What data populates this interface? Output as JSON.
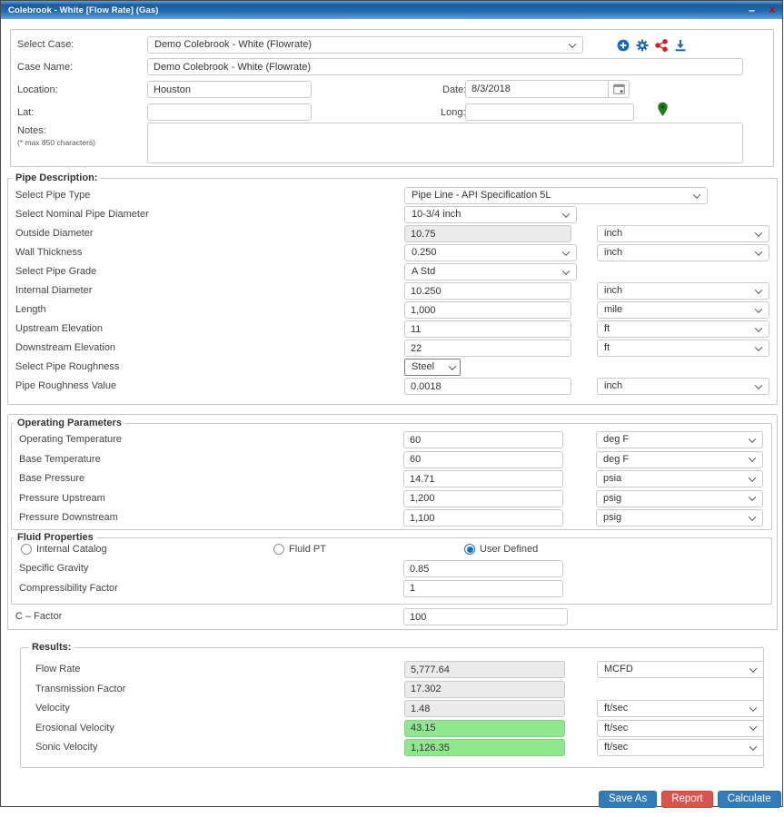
{
  "window": {
    "title": "Colebrook - White [Flow Rate] (Gas)",
    "minimize_label": "–",
    "close_label": "x"
  },
  "header_icons": [
    {
      "name": "add-circle-icon"
    },
    {
      "name": "gear-icon"
    },
    {
      "name": "share-icon"
    },
    {
      "name": "download-icon"
    }
  ],
  "case": {
    "select_case": {
      "label": "Select Case:",
      "value": "Demo Colebrook - White (Flowrate)"
    },
    "case_name": {
      "label": "Case Name:",
      "value": "Demo Colebrook - White (Flowrate)"
    },
    "location": {
      "label": "Location:",
      "value": "Houston"
    },
    "date": {
      "label": "Date:",
      "value": "8/3/2018"
    },
    "lat": {
      "label": "Lat:",
      "value": ""
    },
    "long": {
      "label": "Long:",
      "value": ""
    },
    "notes": {
      "label": "Notes:",
      "hint": "(* max 850 characters)",
      "value": ""
    }
  },
  "pipe": {
    "legend": "Pipe Description:",
    "pipe_type": {
      "label": "Select Pipe Type",
      "value": "Pipe Line - API Specification 5L"
    },
    "nominal_diameter": {
      "label": "Select Nominal Pipe Diameter",
      "value": "10-3/4 inch"
    },
    "outside_diameter": {
      "label": "Outside Diameter",
      "value": "10.75",
      "unit": "inch"
    },
    "wall_thickness": {
      "label": "Wall Thickness",
      "value": "0.250",
      "unit": "inch"
    },
    "pipe_grade": {
      "label": "Select Pipe Grade",
      "value": "A Std"
    },
    "internal_diameter": {
      "label": "Internal Diameter",
      "value": "10.250",
      "unit": "inch"
    },
    "length": {
      "label": "Length",
      "value": "1,000",
      "unit": "mile"
    },
    "upstream_elevation": {
      "label": "Upstream Elevation",
      "value": "11",
      "unit": "ft"
    },
    "downstream_elevation": {
      "label": "Downstream Elevation",
      "value": "22",
      "unit": "ft"
    },
    "pipe_roughness": {
      "label": "Select Pipe Roughness",
      "value": "Steel"
    },
    "roughness_value": {
      "label": "Pipe Roughness Value",
      "value": "0.0018",
      "unit": "inch"
    }
  },
  "operating": {
    "legend": "Operating Parameters",
    "rows": [
      {
        "label": "Operating Temperature",
        "value": "60",
        "unit": "deg F"
      },
      {
        "label": "Base Temperature",
        "value": "60",
        "unit": "deg F"
      },
      {
        "label": "Base Pressure",
        "value": "14.71",
        "unit": "psia"
      },
      {
        "label": "Pressure Upstream",
        "value": "1,200",
        "unit": "psig"
      },
      {
        "label": "Pressure Downstream",
        "value": "1,100",
        "unit": "psig"
      }
    ]
  },
  "fluid": {
    "legend": "Fluid Properties",
    "options": [
      {
        "label": "Internal Catalog",
        "selected": false
      },
      {
        "label": "Fluid PT",
        "selected": false
      },
      {
        "label": "User Defined",
        "selected": true
      }
    ],
    "specific_gravity": {
      "label": "Specific Gravity",
      "value": "0.85"
    },
    "compressibility": {
      "label": "Compressibility Factor",
      "value": "1"
    }
  },
  "c_factor": {
    "label": "C – Factor",
    "value": "100"
  },
  "results": {
    "legend": "Results:",
    "flow_rate": {
      "label": "Flow Rate",
      "value": "5,777.64",
      "unit": "MCFD"
    },
    "transmission_factor": {
      "label": "Transmission Factor",
      "value": "17.302"
    },
    "velocity": {
      "label": "Velocity",
      "value": "1.48",
      "unit": "ft/sec"
    },
    "erosional_velocity": {
      "label": "Erosional Velocity",
      "value": "43.15",
      "unit": "ft/sec"
    },
    "sonic_velocity": {
      "label": "Sonic Velocity",
      "value": "1,126.35",
      "unit": "ft/sec"
    }
  },
  "footer": {
    "save_as": "Save As",
    "report": "Report",
    "calculate": "Calculate"
  },
  "colors": {
    "accent_blue": "#337ab7",
    "danger_red": "#d9534f",
    "result_green": "#8fe78f",
    "readonly_gray": "#ebebeb",
    "title_blue_dark": "#1d5c9e",
    "title_blue_light": "#62a3dc"
  }
}
